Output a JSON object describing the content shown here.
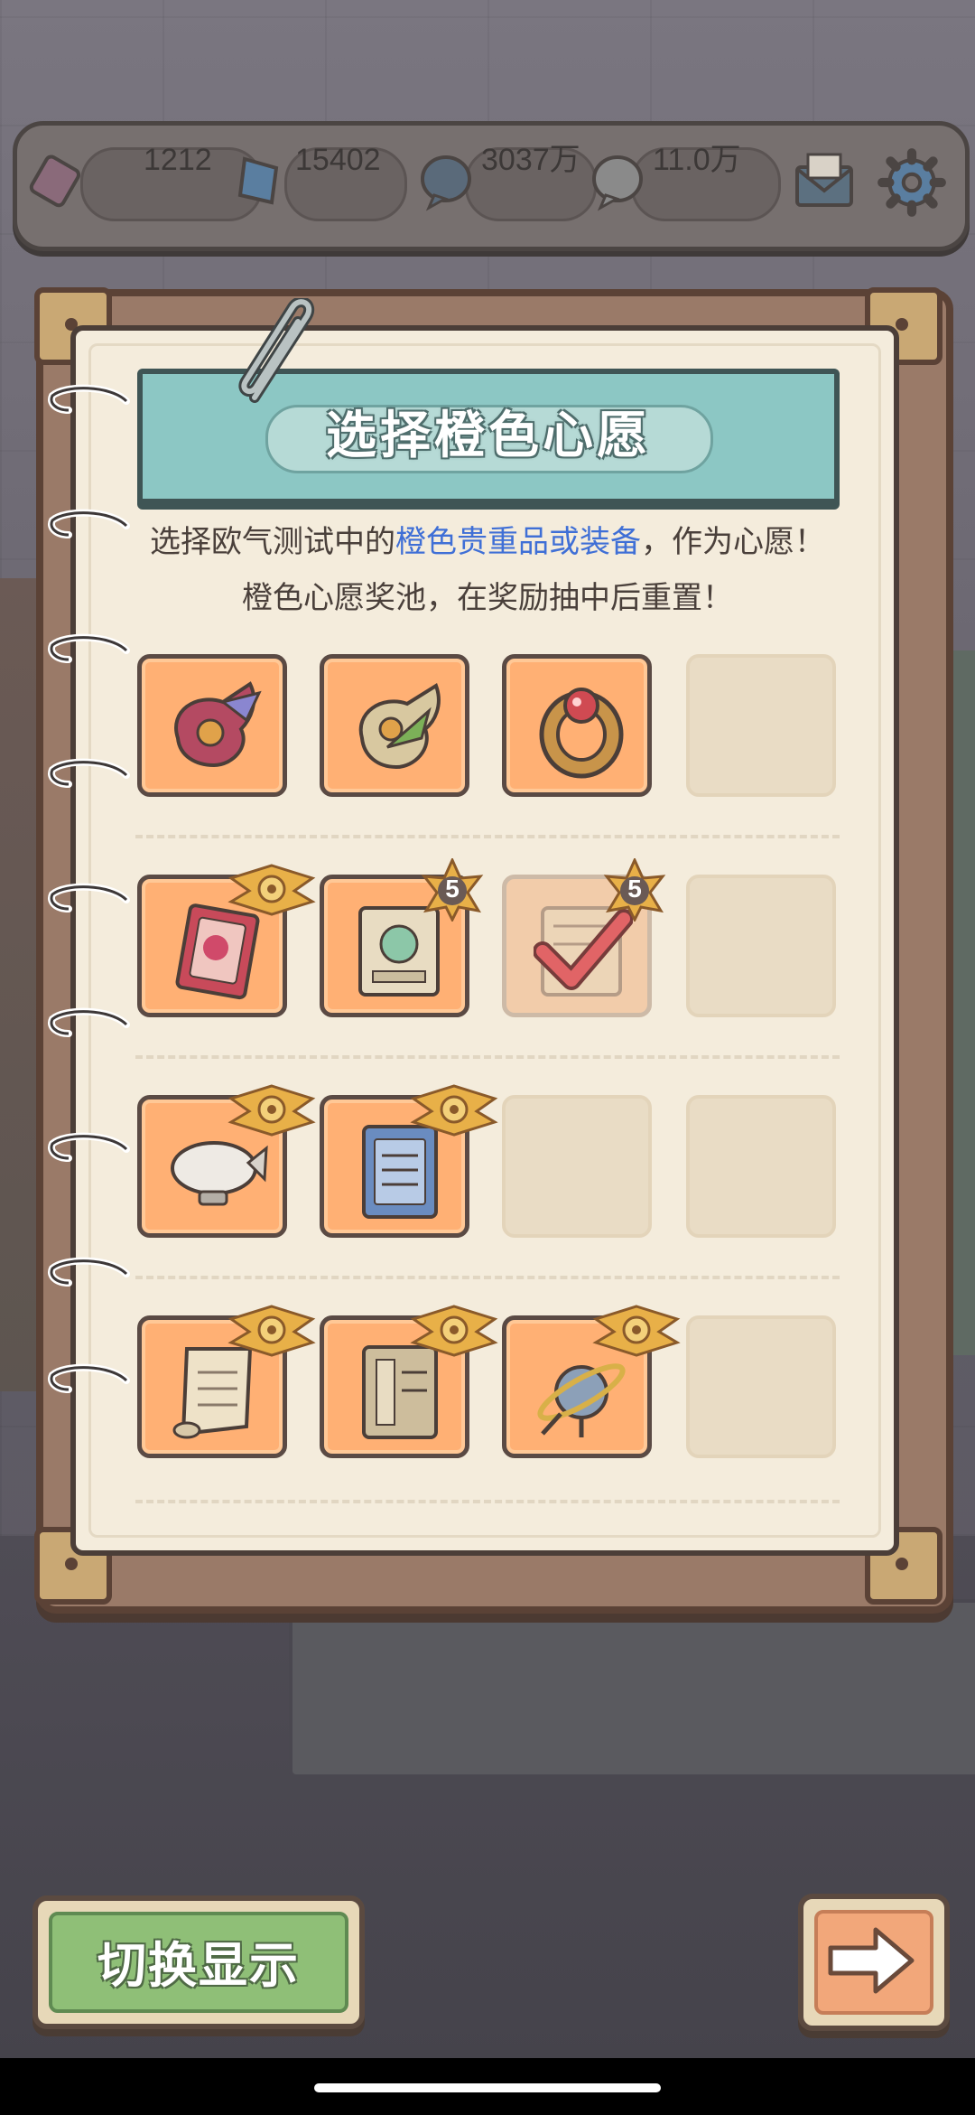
{
  "resources": [
    {
      "name": "ticket",
      "icon": "ticket-icon",
      "value": "1212"
    },
    {
      "name": "gem",
      "icon": "crystal-icon",
      "value": "15402"
    },
    {
      "name": "coin-a",
      "icon": "speech-coin-icon",
      "value": "3037万"
    },
    {
      "name": "coin-b",
      "icon": "speech-coin-light-icon",
      "value": "11.0万"
    }
  ],
  "header": {
    "mail_icon": "mail-icon",
    "settings_icon": "gear-icon"
  },
  "panel": {
    "title": "选择橙色心愿",
    "desc_line1_a": "选择欧气测试中的",
    "desc_line1_hl": "橙色贵重品或装备",
    "desc_line1_b": "，作为心愿！",
    "desc_line2": "橙色心愿奖池，在奖励抽中后重置！",
    "highlight_color": "#3f6fd6"
  },
  "grid": [
    [
      {
        "state": "filled",
        "item": "winged-helmet-red-icon",
        "badge": ""
      },
      {
        "state": "filled",
        "item": "winged-helmet-green-icon",
        "badge": ""
      },
      {
        "state": "filled",
        "item": "ruby-ring-icon",
        "badge": ""
      },
      {
        "state": "empty",
        "item": "",
        "badge": ""
      }
    ],
    [
      {
        "state": "filled",
        "item": "red-card-icon",
        "badge": "wings"
      },
      {
        "state": "filled",
        "item": "globe-certificate-icon",
        "badge": "5"
      },
      {
        "state": "selected",
        "item": "scroll-book-icon",
        "badge": "5"
      },
      {
        "state": "empty",
        "item": "",
        "badge": ""
      }
    ],
    [
      {
        "state": "filled",
        "item": "airship-icon",
        "badge": "wings"
      },
      {
        "state": "filled",
        "item": "blue-book-icon",
        "badge": "wings"
      },
      {
        "state": "empty",
        "item": "",
        "badge": ""
      },
      {
        "state": "empty",
        "item": "",
        "badge": ""
      }
    ],
    [
      {
        "state": "filled",
        "item": "parchment-scroll-icon",
        "badge": "wings"
      },
      {
        "state": "filled",
        "item": "old-book-icon",
        "badge": "wings"
      },
      {
        "state": "filled",
        "item": "satellite-icon",
        "badge": "wings"
      },
      {
        "state": "empty",
        "item": "",
        "badge": ""
      }
    ]
  ],
  "buttons": {
    "switch_label": "切换显示",
    "next_icon": "arrow-right-icon"
  }
}
